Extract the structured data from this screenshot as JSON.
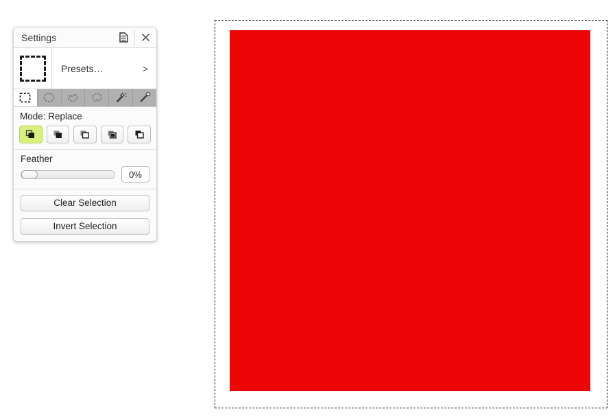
{
  "panel": {
    "title": "Settings",
    "titlebar_buttons": [
      {
        "name": "menu-icon",
        "glyph": "document-list"
      },
      {
        "name": "close-icon",
        "glyph": "x"
      }
    ],
    "presets": {
      "thumbnail_name": "rectangle-select-preset-thumbnail",
      "label": "Presets…",
      "chevron": ">"
    },
    "tools": [
      {
        "name": "rectangle-select-tool",
        "label": "Rectangle Select",
        "active": true
      },
      {
        "name": "ellipse-select-tool",
        "label": "Ellipse Select",
        "active": false
      },
      {
        "name": "polygon-select-tool",
        "label": "Polygon Select",
        "active": false
      },
      {
        "name": "lasso-select-tool",
        "label": "Lasso Select",
        "active": false
      },
      {
        "name": "magic-wand-tool",
        "label": "Magic Wand",
        "active": false
      },
      {
        "name": "color-picker-tool",
        "label": "Color Picker",
        "active": false
      }
    ],
    "mode": {
      "label": "Mode: Replace",
      "selected_index": 0,
      "options": [
        {
          "name": "mode-replace",
          "label": "Replace"
        },
        {
          "name": "mode-union",
          "label": "Union"
        },
        {
          "name": "mode-exclude",
          "label": "Exclude"
        },
        {
          "name": "mode-xor",
          "label": "Xor"
        },
        {
          "name": "mode-intersect",
          "label": "Intersect"
        }
      ]
    },
    "feather": {
      "label": "Feather",
      "value": "0%",
      "slider_percent": 0
    },
    "actions": [
      {
        "name": "clear-selection-button",
        "label": "Clear Selection"
      },
      {
        "name": "invert-selection-button",
        "label": "Invert Selection"
      }
    ]
  },
  "canvas": {
    "name": "drawing-canvas",
    "shape": {
      "name": "red-rectangle-shape",
      "color": "#ec0606"
    }
  },
  "colors": {
    "accent_selected": "#d9f07a",
    "shape_red": "#ec0606",
    "panel_bg": "#fbfbfb",
    "toolbar_bg": "#b0b0b0"
  }
}
